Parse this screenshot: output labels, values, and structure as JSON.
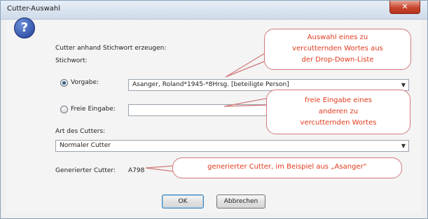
{
  "window": {
    "title": "Cutter-Auswahl",
    "close": "✕"
  },
  "dialog": {
    "heading": "Cutter anhand Stichwort erzeugen:",
    "stichwort_label": "Stichwort:",
    "vorgabe_label": "Vorgabe:",
    "vorgabe_value": "Asanger, Roland*1945-*8Hrsg. [beteiligte Person]",
    "freie_label": "Freie Eingabe:",
    "freie_value": "",
    "art_label": "Art des Cutters:",
    "art_value": "Normaler Cutter",
    "generated_label": "Generierter Cutter:",
    "generated_value": "A798",
    "ok": "OK",
    "cancel": "Abbrechen"
  },
  "annotations": {
    "callout1": [
      "Auswahl eines zu",
      "vercutternden Wortes aus",
      "der Drop-Down-Liste"
    ],
    "callout2": [
      "freie Eingabe eines",
      "anderen zu",
      "vercutternden Wortes"
    ],
    "callout3": "generierter Cutter, im Beispiel aus „Asanger“",
    "color": "#e2391e"
  }
}
